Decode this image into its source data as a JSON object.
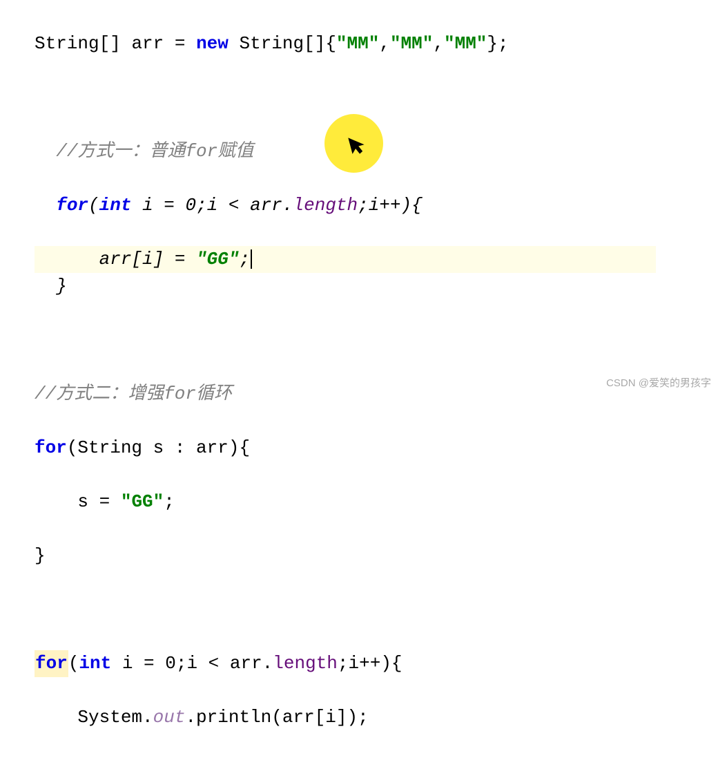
{
  "code": {
    "line1": {
      "type": "String",
      "arrName": "arr",
      "newKw": "new",
      "typeArr": "String",
      "val1": "\"MM\"",
      "val2": "\"MM\"",
      "val3": "\"MM\""
    },
    "comment1": "//方式一：普通for赋值",
    "for1": {
      "forKw": "for",
      "intKw": "int",
      "init": "i = 0",
      "cond_var": "i < arr.",
      "cond_field": "length",
      "cond_end": ";i++){",
      "body_left": "arr[i] = ",
      "body_str": "\"GG\"",
      "body_end": ";",
      "close": "}"
    },
    "comment2": "//方式二：增强for循环",
    "for2": {
      "forKw": "for",
      "head": "(String s : arr){",
      "body_left": "s = ",
      "body_str": "\"GG\"",
      "body_end": ";",
      "close": "}"
    },
    "for3": {
      "forKw": "for",
      "intKw": "int",
      "init": "i = 0",
      "cond_var": ";i < arr.",
      "cond_field": "length",
      "cond_end": ";i++){",
      "sys": "System.",
      "out": "out",
      "print": ".println(arr[i]);"
    }
  },
  "watermark": "CSDN @爱笑的男孩字"
}
